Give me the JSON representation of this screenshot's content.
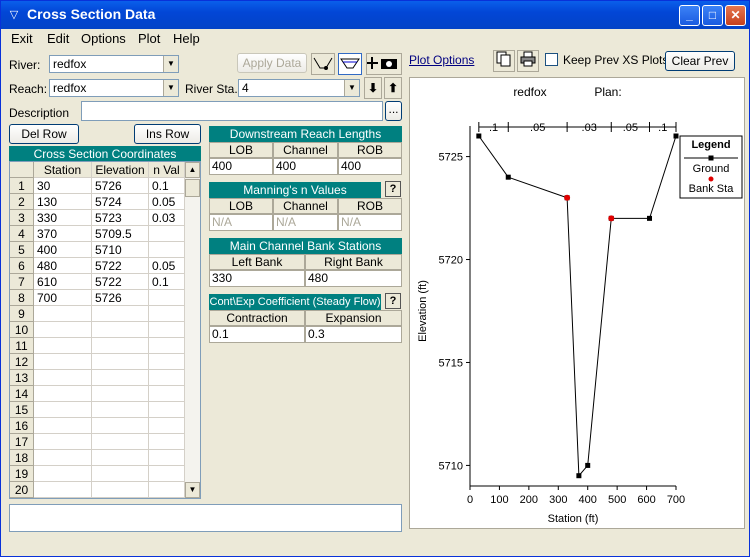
{
  "window": {
    "title": "Cross Section Data"
  },
  "menu": [
    "Exit",
    "Edit",
    "Options",
    "Plot",
    "Help"
  ],
  "toolbar": {
    "river_label": "River:",
    "river_value": "redfox",
    "reach_label": "Reach:",
    "reach_value": "redfox",
    "river_sta_label": "River Sta.:",
    "river_sta_value": "4",
    "apply_data": "Apply Data",
    "description_label": "Description",
    "plot_options": "Plot Options",
    "keep_prev": "Keep Prev XS Plots",
    "clear_prev": "Clear Prev",
    "del_row": "Del Row",
    "ins_row": "Ins Row",
    "ellipsis": "..."
  },
  "xs_coords": {
    "title": "Cross Section Coordinates",
    "columns": [
      "Station",
      "Elevation",
      "n Val"
    ],
    "rows": [
      [
        "30",
        "5726",
        "0.1"
      ],
      [
        "130",
        "5724",
        "0.05"
      ],
      [
        "330",
        "5723",
        "0.03"
      ],
      [
        "370",
        "5709.5",
        ""
      ],
      [
        "400",
        "5710",
        ""
      ],
      [
        "480",
        "5722",
        "0.05"
      ],
      [
        "610",
        "5722",
        "0.1"
      ],
      [
        "700",
        "5726",
        ""
      ],
      [
        "",
        "",
        ""
      ],
      [
        "",
        "",
        ""
      ],
      [
        "",
        "",
        ""
      ],
      [
        "",
        "",
        ""
      ],
      [
        "",
        "",
        ""
      ],
      [
        "",
        "",
        ""
      ],
      [
        "",
        "",
        ""
      ],
      [
        "",
        "",
        ""
      ],
      [
        "",
        "",
        ""
      ],
      [
        "",
        "",
        ""
      ],
      [
        "",
        "",
        ""
      ],
      [
        "",
        "",
        ""
      ]
    ]
  },
  "downstream": {
    "title": "Downstream Reach Lengths",
    "headers": [
      "LOB",
      "Channel",
      "ROB"
    ],
    "values": [
      "400",
      "400",
      "400"
    ]
  },
  "mannings": {
    "title": "Manning's n Values",
    "headers": [
      "LOB",
      "Channel",
      "ROB"
    ],
    "values": [
      "N/A",
      "N/A",
      "N/A"
    ]
  },
  "bank_stations": {
    "title": "Main Channel Bank Stations",
    "headers": [
      "Left Bank",
      "Right Bank"
    ],
    "values": [
      "330",
      "480"
    ]
  },
  "contexp": {
    "title": "Cont\\Exp Coefficient (Steady Flow)",
    "headers": [
      "Contraction",
      "Expansion"
    ],
    "values": [
      "0.1",
      "0.3"
    ]
  },
  "chart_data": {
    "type": "line",
    "title_left": "redfox",
    "title_right": "Plan:",
    "xlabel": "Station (ft)",
    "ylabel": "Elevation (ft)",
    "xlim": [
      0,
      700
    ],
    "ylim": [
      5709,
      5726
    ],
    "xticks": [
      0,
      100,
      200,
      300,
      400,
      500,
      600,
      700
    ],
    "yticks": [
      5710,
      5715,
      5720,
      5725
    ],
    "ground": {
      "x": [
        30,
        130,
        330,
        370,
        400,
        480,
        610,
        700
      ],
      "y": [
        5726,
        5724,
        5723,
        5709.5,
        5710,
        5722,
        5722,
        5726
      ]
    },
    "bank_sta": {
      "x": [
        330,
        480
      ],
      "y": [
        5723,
        5722
      ]
    },
    "n_labels": [
      {
        "x": 80,
        "t": ".1"
      },
      {
        "x": 230,
        "t": ".05"
      },
      {
        "x": 405,
        "t": ".03"
      },
      {
        "x": 545,
        "t": ".05"
      },
      {
        "x": 655,
        "t": ".1"
      }
    ],
    "legend": {
      "title": "Legend",
      "items": [
        "Ground",
        "Bank Sta"
      ]
    },
    "colors": {
      "ground": "#000000",
      "bank": "#E00000"
    }
  }
}
